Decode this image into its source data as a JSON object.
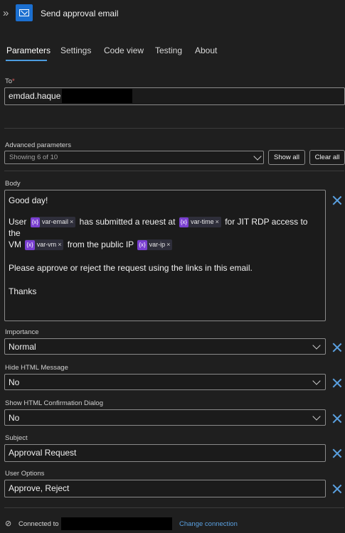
{
  "header": {
    "expand_icon": "double-chevron-right-icon",
    "app_icon": "outlook-mail-icon",
    "title": "Send approval email"
  },
  "tabs": [
    {
      "label": "Parameters",
      "active": true
    },
    {
      "label": "Settings"
    },
    {
      "label": "Code view"
    },
    {
      "label": "Testing"
    },
    {
      "label": "About"
    }
  ],
  "to": {
    "label": "To",
    "required_mark": "*",
    "value": "emdad.haque"
  },
  "advanced": {
    "label": "Advanced parameters",
    "select_value": "Showing 6 of 10",
    "show_all": "Show all",
    "clear_all": "Clear all"
  },
  "body": {
    "label": "Body",
    "line1": "Good day!",
    "l2a": "User",
    "tok_email": "var-email",
    "l2b": "has submitted a reuest at",
    "tok_time": "var-time",
    "l2c": "for JIT RDP access to the",
    "l3a": "VM",
    "tok_vm": "var-vm",
    "l3b": "from the public IP",
    "tok_ip": "var-ip",
    "token_icon": "{x}",
    "token_remove": "×",
    "line4": "Please approve or reject the request using the links in this email.",
    "line5": "Thanks"
  },
  "importance": {
    "label": "Importance",
    "value": "Normal"
  },
  "hide_html": {
    "label": "Hide HTML Message",
    "value": "No"
  },
  "confirm_dialog": {
    "label": "Show HTML Confirmation Dialog",
    "value": "No"
  },
  "subject": {
    "label": "Subject",
    "value": "Approval Request"
  },
  "user_options": {
    "label": "User Options",
    "value": "Approve, Reject"
  },
  "footer": {
    "connected_to": "Connected to",
    "change_connection": "Change connection"
  },
  "colors": {
    "accent": "#4c9de0",
    "token_icon": "#7a3fd1",
    "background": "#1f1f1f"
  }
}
